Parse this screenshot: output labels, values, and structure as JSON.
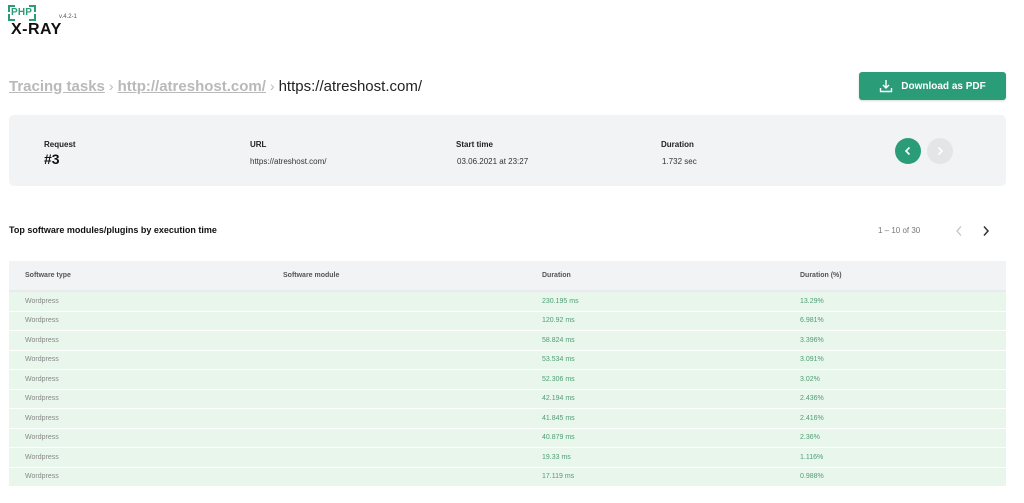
{
  "logo": {
    "php": "PHP",
    "xray": "X-RAY",
    "version": "v.4.2-1",
    "accent_color": "#2a9d78"
  },
  "breadcrumb": {
    "items": [
      "Tracing tasks",
      "http://atreshost.com/"
    ],
    "current": "https://atreshost.com/"
  },
  "toolbar": {
    "download_label": "Download as PDF",
    "download_icon": "download-icon"
  },
  "request_info": {
    "request_label": "Request",
    "request_value": "#3",
    "url_label": "URL",
    "url_value": "https://atreshost.com/",
    "start_label": "Start time",
    "start_value": "03.06.2021 at 23:27",
    "duration_label": "Duration",
    "duration_value": "1.732 sec",
    "prev_icon": "chevron-left-icon",
    "next_icon": "chevron-right-icon"
  },
  "section": {
    "title": "Top software modules/plugins by execution time"
  },
  "pagination": {
    "text": "1 – 10 of 30"
  },
  "table": {
    "columns": [
      "Software type",
      "Software module",
      "Duration",
      "Duration (%)"
    ],
    "rows": [
      {
        "type": "Wordpress",
        "module": "",
        "duration": "230.195 ms",
        "percent": "13.29%"
      },
      {
        "type": "Wordpress",
        "module": "",
        "duration": "120.92 ms",
        "percent": "6.981%"
      },
      {
        "type": "Wordpress",
        "module": "",
        "duration": "58.824 ms",
        "percent": "3.396%"
      },
      {
        "type": "Wordpress",
        "module": "",
        "duration": "53.534 ms",
        "percent": "3.091%"
      },
      {
        "type": "Wordpress",
        "module": "",
        "duration": "52.306 ms",
        "percent": "3.02%"
      },
      {
        "type": "Wordpress",
        "module": "",
        "duration": "42.194 ms",
        "percent": "2.436%"
      },
      {
        "type": "Wordpress",
        "module": "",
        "duration": "41.845 ms",
        "percent": "2.416%"
      },
      {
        "type": "Wordpress",
        "module": "",
        "duration": "40.879 ms",
        "percent": "2.36%"
      },
      {
        "type": "Wordpress",
        "module": "",
        "duration": "19.33 ms",
        "percent": "1.116%"
      },
      {
        "type": "Wordpress",
        "module": "",
        "duration": "17.119 ms",
        "percent": "0.988%"
      }
    ]
  }
}
